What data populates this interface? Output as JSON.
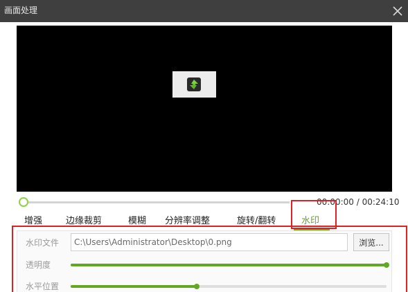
{
  "window": {
    "title": "画面处理"
  },
  "player": {
    "time_display": "00:00:00 / 00:24:10",
    "progress_fraction": 0.0
  },
  "tabs": [
    {
      "label": "增强"
    },
    {
      "label": "边缘裁剪"
    },
    {
      "label": "模糊"
    },
    {
      "label": "分辨率调整"
    },
    {
      "label": "旋转/翻转"
    },
    {
      "label": "水印",
      "active": true
    }
  ],
  "watermark": {
    "file_label": "水印文件",
    "file_value": "C:\\Users\\Administrator\\Desktop\\0.png",
    "browse_label": "浏览...",
    "opacity_label": "透明度",
    "opacity_value": 1.0,
    "horizontal_label": "水平位置",
    "horizontal_value": 0.4
  },
  "icons": {
    "close": "close-icon",
    "logo": "app-logo-icon"
  },
  "colors": {
    "accent": "#62a822",
    "highlight": "#e02020",
    "titlebar": "#3f3f3f"
  }
}
